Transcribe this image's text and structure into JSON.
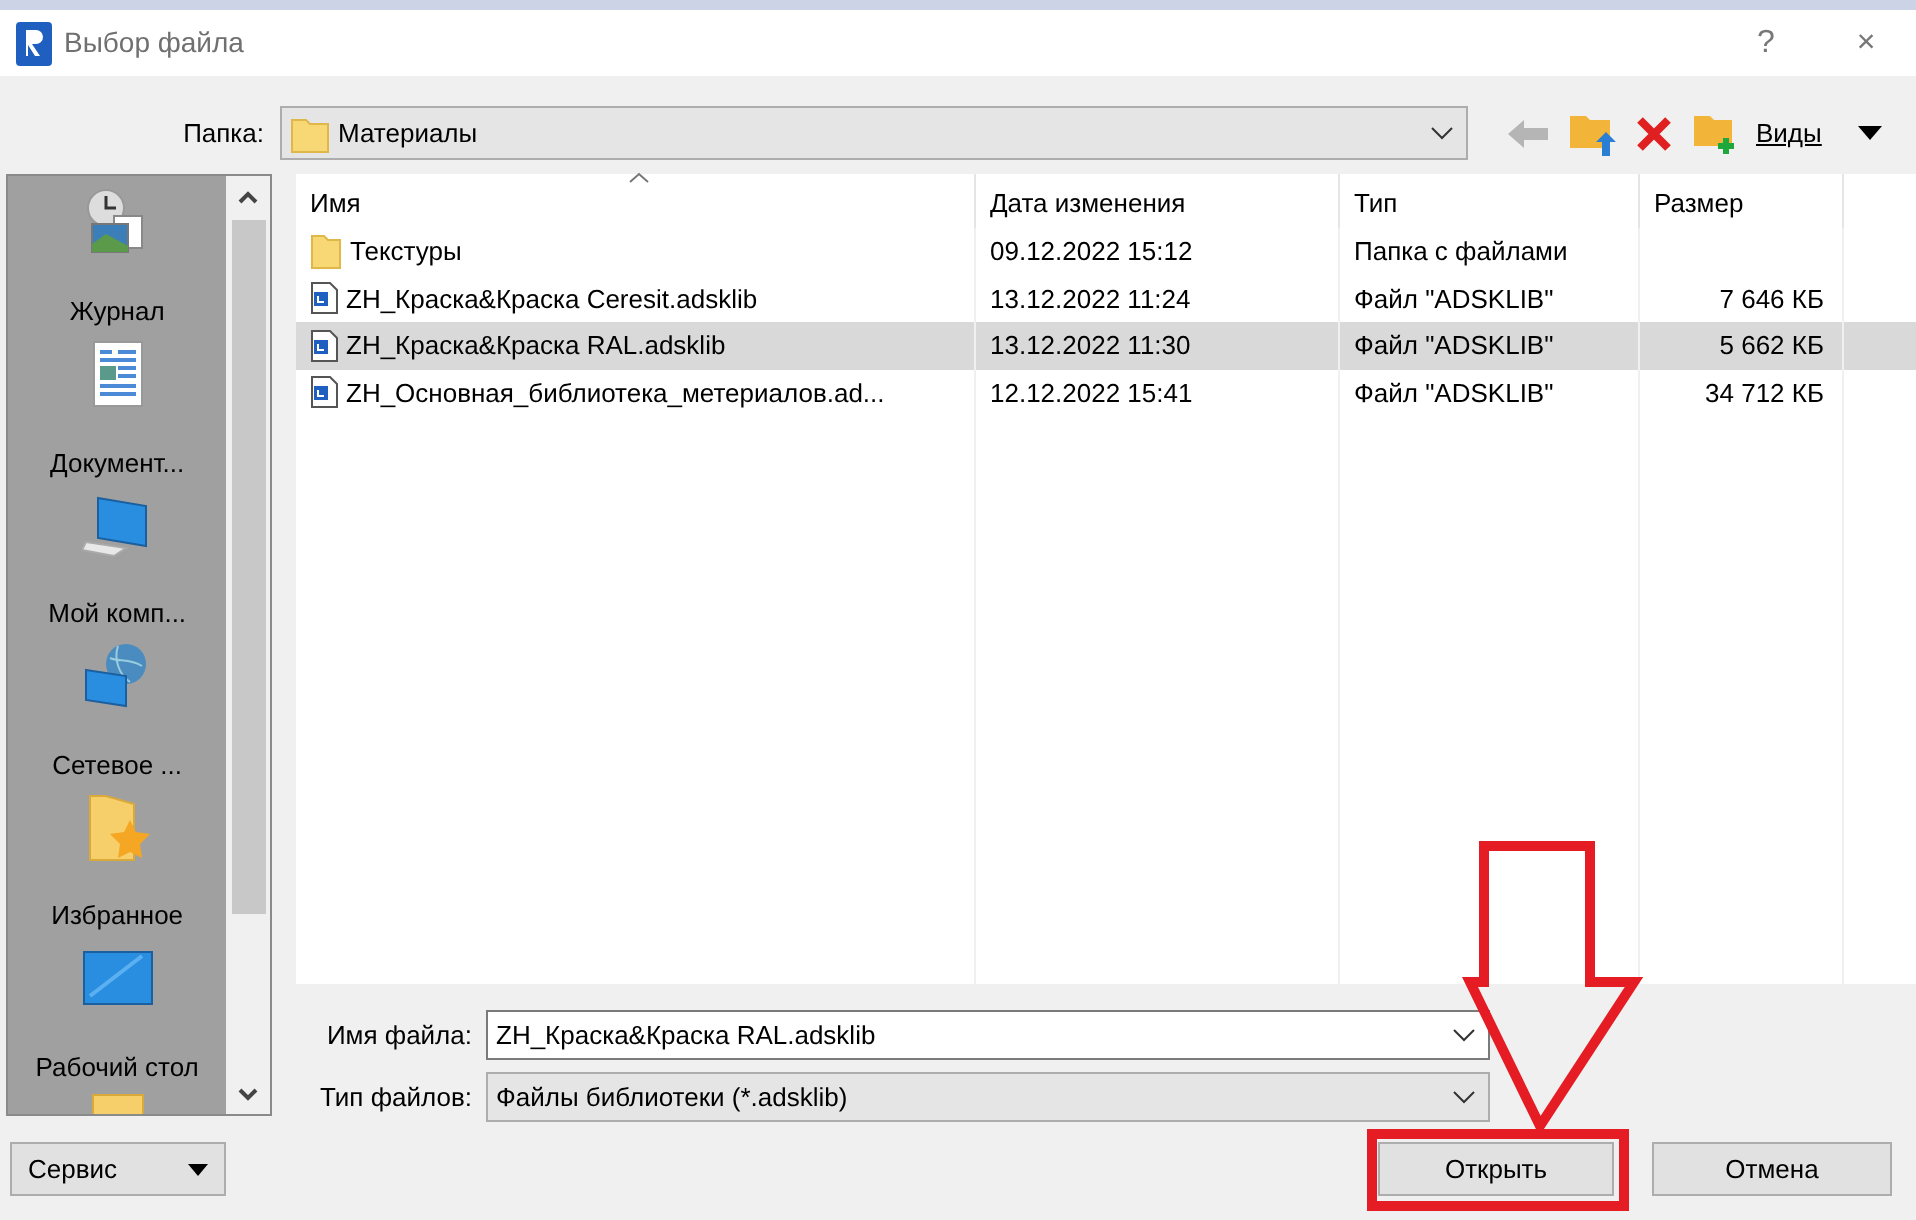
{
  "window": {
    "title": "Выбор файла",
    "help": "?",
    "close": "×"
  },
  "folder": {
    "label": "Папка:",
    "value": "Материалы"
  },
  "toolbar": {
    "views": "Виды"
  },
  "sidebar": {
    "items": [
      {
        "label": "Журнал"
      },
      {
        "label": "Документ..."
      },
      {
        "label": "Мой комп..."
      },
      {
        "label": "Сетевое ..."
      },
      {
        "label": "Избранное"
      },
      {
        "label": "Рабочий стол"
      }
    ]
  },
  "table": {
    "columns": [
      "Имя",
      "Дата изменения",
      "Тип",
      "Размер"
    ],
    "rows": [
      {
        "kind": "folder",
        "name": "Текстуры",
        "date": "09.12.2022 15:12",
        "type": "Папка с файлами",
        "size": "",
        "selected": false
      },
      {
        "kind": "file",
        "name": "ZH_Краска&Краска Ceresit.adsklib",
        "date": "13.12.2022 11:24",
        "type": "Файл \"ADSKLIB\"",
        "size": "7 646 КБ",
        "selected": false
      },
      {
        "kind": "file",
        "name": "ZH_Краска&Краска RAL.adsklib",
        "date": "13.12.2022 11:30",
        "type": "Файл \"ADSKLIB\"",
        "size": "5 662 КБ",
        "selected": true
      },
      {
        "kind": "file",
        "name": "ZH_Основная_библиотека_метериалов.ad...",
        "date": "12.12.2022 15:41",
        "type": "Файл \"ADSKLIB\"",
        "size": "34 712 КБ",
        "selected": false
      }
    ]
  },
  "file_name": {
    "label": "Имя файла:",
    "value": "ZH_Краска&Краска RAL.adsklib"
  },
  "file_type": {
    "label": "Тип файлов:",
    "value": "Файлы библиотеки  (*.adsklib)"
  },
  "buttons": {
    "service": "Сервис",
    "open": "Открыть",
    "cancel": "Отмена"
  },
  "annotations": {
    "arrow": true,
    "frame": true
  }
}
